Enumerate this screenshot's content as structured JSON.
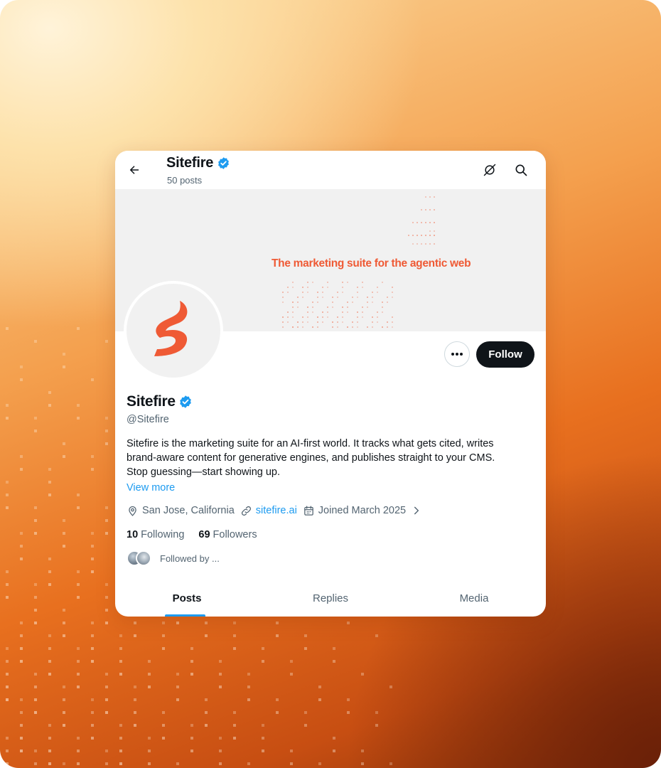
{
  "header": {
    "name": "Sitefire",
    "posts_count": "50 posts"
  },
  "banner": {
    "tagline": "The marketing suite for the agentic web"
  },
  "profile": {
    "name": "Sitefire",
    "handle": "@Sitefire",
    "verified": true,
    "bio_lines": [
      "Sitefire is the marketing suite for an AI-first world. It tracks what gets cited, writes",
      "brand-aware content for generative engines, and publishes straight to your CMS.",
      "Stop guessing—start showing up."
    ],
    "view_more": "View more",
    "location": "San Jose, California",
    "website": "sitefire.ai",
    "joined": "Joined March 2025",
    "following_count": "10",
    "following_label": "Following",
    "followers_count": "69",
    "followers_label": "Followers",
    "followed_by": "Followed by ..."
  },
  "actions": {
    "follow_label": "Follow"
  },
  "tabs": [
    {
      "label": "Posts",
      "active": true
    },
    {
      "label": "Replies",
      "active": false
    },
    {
      "label": "Media",
      "active": false
    }
  ],
  "colors": {
    "brand": "#ef5a35",
    "link": "#1d9bf0",
    "verified": "#1d9bf0",
    "text": "#0f1419",
    "muted": "#536471"
  },
  "icons": [
    "back-arrow-icon",
    "verified-badge-icon",
    "grok-icon",
    "search-icon",
    "more-dots-icon",
    "location-pin-icon",
    "link-icon",
    "calendar-icon",
    "chevron-right-icon",
    "sitefire-logo"
  ]
}
